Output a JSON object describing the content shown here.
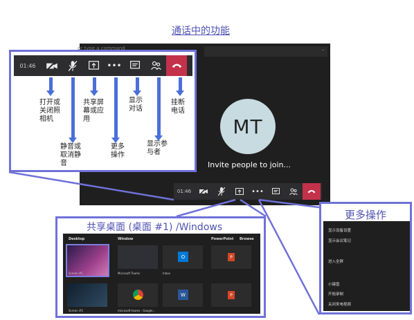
{
  "page": {
    "title": "通话中的功能"
  },
  "window": {
    "command_placeholder": "or type a command",
    "avatar_initials": "MT",
    "invite_text": "Invite people to join..."
  },
  "toolbar": {
    "time": "01:46",
    "buttons": [
      "camera-off-icon",
      "mic-off-icon",
      "share-screen-icon",
      "more-options-icon",
      "chat-icon",
      "participants-icon",
      "hang-up-icon"
    ]
  },
  "labels": {
    "camera": "打开或\n关闭照\n相机",
    "mic": "静音或\n取消静\n音",
    "share": "共享屏\n幕或应\n用",
    "more": "更多\n操作",
    "chat": "显示\n对话",
    "participants": "显示参\n与者",
    "hangup": "挂断\n电话"
  },
  "share": {
    "title": "共享桌面 (桌面 #1) /Windows",
    "headers": {
      "desktop": "Desktop",
      "window": "Window",
      "powerpoint": "PowerPoint",
      "browse": "Browse"
    },
    "tiles": [
      {
        "caption": "Screen #1"
      },
      {
        "caption": "Microsoft Teams"
      },
      {
        "caption": "Inbox"
      },
      {
        "caption": ""
      },
      {
        "caption": "Screen #2"
      },
      {
        "caption": "microsoft teams - Google..."
      },
      {
        "caption": ""
      },
      {
        "caption": ""
      }
    ]
  },
  "more_actions": {
    "title": "更多操作",
    "items": [
      {
        "label": "显示设备设置",
        "enabled": true
      },
      {
        "label": "显示会议笔记",
        "enabled": true
      },
      {
        "label": "",
        "enabled": false
      },
      {
        "label": "进入全屏",
        "enabled": true
      },
      {
        "label": "",
        "enabled": true
      },
      {
        "label": "小键盘",
        "enabled": true
      },
      {
        "label": "开始录制",
        "enabled": true
      },
      {
        "label": "关闭来电视频",
        "enabled": true
      }
    ]
  },
  "colors": {
    "accent": "#6f72d8",
    "hangup": "#c4314b",
    "dark": "#1f1f1f",
    "avatar_bg": "#c7dbe0"
  }
}
